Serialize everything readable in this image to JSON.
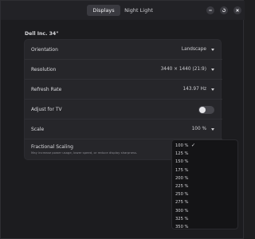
{
  "header": {
    "tabs": [
      {
        "label": "Displays",
        "active": true
      },
      {
        "label": "Night Light",
        "active": false
      }
    ],
    "window_buttons": [
      "minimize-icon",
      "restore-icon",
      "close-icon"
    ]
  },
  "monitor": {
    "name": "Dell Inc. 34\""
  },
  "settings": {
    "orientation": {
      "label": "Orientation",
      "value": "Landscape"
    },
    "resolution": {
      "label": "Resolution",
      "value": "3440 × 1440 (21:9)"
    },
    "refresh": {
      "label": "Refresh Rate",
      "value": "143.97 Hz"
    },
    "adjust_tv": {
      "label": "Adjust for TV",
      "enabled": false
    },
    "scale": {
      "label": "Scale",
      "value": "100 %"
    },
    "fractional": {
      "label": "Fractional Scaling",
      "description": "May increase power usage, lower speed, or reduce display sharpness."
    }
  },
  "scale_menu": {
    "selected_index": 0,
    "options": [
      "100 %",
      "125 %",
      "150 %",
      "175 %",
      "200 %",
      "225 %",
      "250 %",
      "275 %",
      "300 %",
      "325 %",
      "350 %"
    ]
  },
  "colors": {
    "background": "#1c1c1f",
    "panel": "#26262a",
    "dropdown": "#141416",
    "text": "#e2e2e6"
  }
}
